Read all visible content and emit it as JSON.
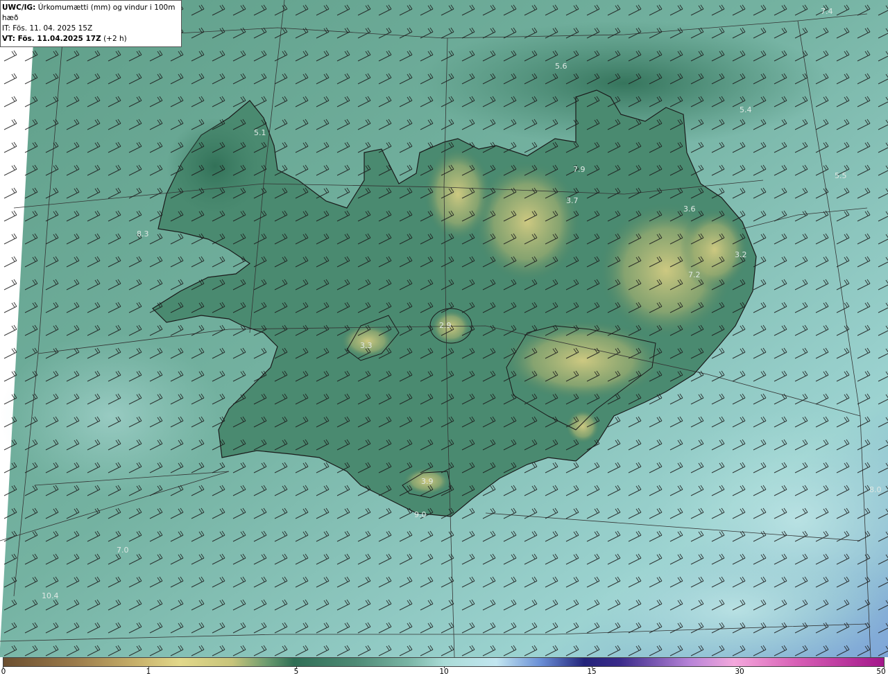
{
  "info": {
    "model": "UWC/IG:",
    "title": "Úrkomumætti (mm) og vindur i 100m hæð",
    "it": "IT: Fös. 11. 04. 2025 15Z",
    "vt_label": "VT: Fös. 11.04.2025 17Z",
    "vt_offset": "(+2 h)"
  },
  "map_values": [
    {
      "text": "7.4"
    },
    {
      "text": "5.6"
    },
    {
      "text": "5.4"
    },
    {
      "text": "5.1"
    },
    {
      "text": "7.9"
    },
    {
      "text": "5.5"
    },
    {
      "text": "3.7"
    },
    {
      "text": "3.6"
    },
    {
      "text": "3.2"
    },
    {
      "text": "7.2"
    },
    {
      "text": "3.3"
    },
    {
      "text": "2.9"
    },
    {
      "text": "3.9"
    },
    {
      "text": "8.0"
    },
    {
      "text": "7.0"
    },
    {
      "text": "10.4"
    },
    {
      "text": "8.3"
    },
    {
      "text": "9.0"
    }
  ],
  "colorbar": {
    "ticks": [
      "0",
      "1",
      "5",
      "10",
      "15",
      "30",
      "50"
    ],
    "colors": {
      "low": "#6b4e2f",
      "mid": "#2f6e55",
      "light": "#a9dbd6",
      "high": "#a3178a"
    }
  },
  "map_colors": {
    "sea": "#7bb8a8",
    "land_dry": "#c9c07a",
    "land_wet": "#3f7f66",
    "barb": "#1a1a1a"
  }
}
